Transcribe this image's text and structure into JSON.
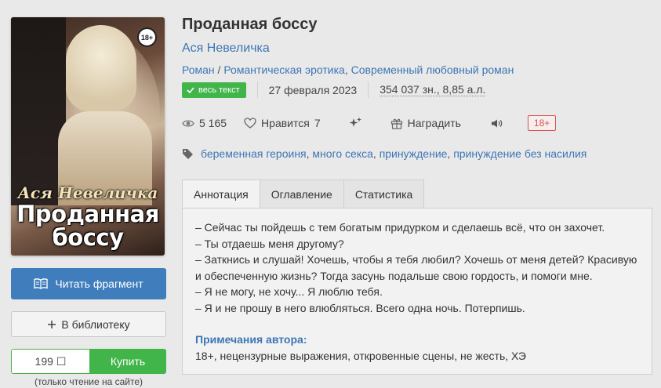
{
  "cover": {
    "age_badge": "18+",
    "author_text": "Ася Невеличка",
    "title_text": "Проданная боссу"
  },
  "actions": {
    "read_label": "Читать фрагмент",
    "library_label": "В библиотеку",
    "price_value": "199",
    "currency_symbol": "☐",
    "buy_label": "Купить",
    "buy_note": "(только чтение на сайте)"
  },
  "book": {
    "title": "Проданная боссу",
    "author": "Ася Невеличка",
    "genres": [
      "Роман",
      "Романтическая эротика",
      "Современный любовный роман"
    ],
    "genre_sep_1": " / ",
    "genre_sep_2": ", ",
    "status_badge": "весь текст",
    "date": "27 февраля 2023",
    "size": "354 037 зн., 8,85 а.л."
  },
  "stats": {
    "views": "5 165",
    "likes_label": "Нравится",
    "likes_count": "7",
    "reward_label": "Наградить",
    "age_rating": "18+"
  },
  "tags": [
    "беременная героиня",
    "много секса",
    "принуждение",
    "принуждение без насилия"
  ],
  "tabs": [
    "Аннотация",
    "Оглавление",
    "Статистика"
  ],
  "annotation": {
    "lines": [
      "– Сейчас ты пойдешь с тем богатым придурком и сделаешь всё, что он захочет.",
      "– Ты отдаешь меня другому?",
      "– Заткнись и слушай! Хочешь, чтобы я тебя любил? Хочешь от меня детей? Красивую и обеспеченную жизнь? Тогда засунь подальше свою гордость, и помоги мне.",
      "– Я не могу, не хочу... Я люблю тебя.",
      "– Я и не прошу в него влюбляться. Всего одна ночь. Потерпишь."
    ],
    "notes_heading": "Примечания автора:",
    "notes_text": "18+, нецензурные выражения, откровенные сцены, не жесть, ХЭ"
  },
  "colors": {
    "accent_blue": "#3f7dbd",
    "link_blue": "#3d76b5",
    "green": "#41b54a",
    "age_red": "#d9534f"
  }
}
